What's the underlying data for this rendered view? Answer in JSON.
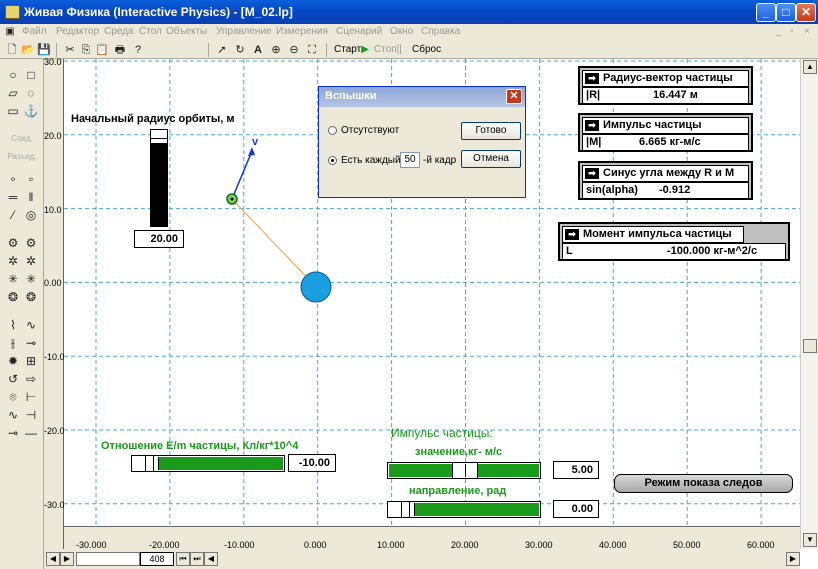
{
  "window": {
    "title": "Живая Физика (Interactive Physics) - [M_02.lp]"
  },
  "menu": [
    "Файл",
    "Редактор",
    "Среда",
    "Стол",
    "Объекты",
    "Управление",
    "Измерения",
    "Сценарий",
    "Окно",
    "Справка"
  ],
  "toolbar": {
    "start": "Старт",
    "stop": "Стоп",
    "reset": "Сброс"
  },
  "palette": {
    "join": "Соед.",
    "split": "Разъед."
  },
  "scrollbar": {
    "frame": "408"
  },
  "rulers": {
    "x": [
      "-30.000",
      "-20.000",
      "-10.000",
      "0.000",
      "10.000",
      "20.000",
      "30.000",
      "40.000",
      "50.000",
      "60.000"
    ],
    "y": [
      "30.0",
      "20.0",
      "10.0",
      "0.00",
      "-10.0",
      "-20.0",
      "-30.0"
    ]
  },
  "orbit": {
    "label": "Начальный радиус орбиты, м",
    "value": "20.00",
    "level": 0.85
  },
  "velocity_label": "v",
  "dialog": {
    "title": "Вспышки",
    "option_none": "Отсутствуют",
    "option_every": "Есть каждый",
    "every_value": "50",
    "every_suffix": "-й кадр",
    "ok": "Готово",
    "cancel": "Отмена"
  },
  "meters": [
    {
      "title": "Радиус-вектор частицы",
      "label": "|R|",
      "value": "16.447 м"
    },
    {
      "title": "Импульс частицы",
      "label": "|M|",
      "value": "6.665 кг-м/с"
    },
    {
      "title": "Синус угла между R и M",
      "label": "sin(alpha)",
      "value": "-0.912"
    },
    {
      "title": "Момент импульса частицы",
      "label": "L",
      "value": "-100.000 кг-м^2/с"
    }
  ],
  "charge_ratio": {
    "label": "Отношение E/m частицы, Кл/кг*10^4",
    "value": "-10.00"
  },
  "momentum": {
    "title": "Импульс частицы:",
    "magnitude_label": "значение,кг- м/с",
    "magnitude_value": "5.00",
    "direction_label": "направление, рад",
    "direction_value": "0.00"
  },
  "trace_button": "Режим показа следов",
  "colors": {
    "grid": "#4aa8d8",
    "slider": "#1a9a1a",
    "ball": "#1aa0e0",
    "particle": "#7ad060"
  }
}
